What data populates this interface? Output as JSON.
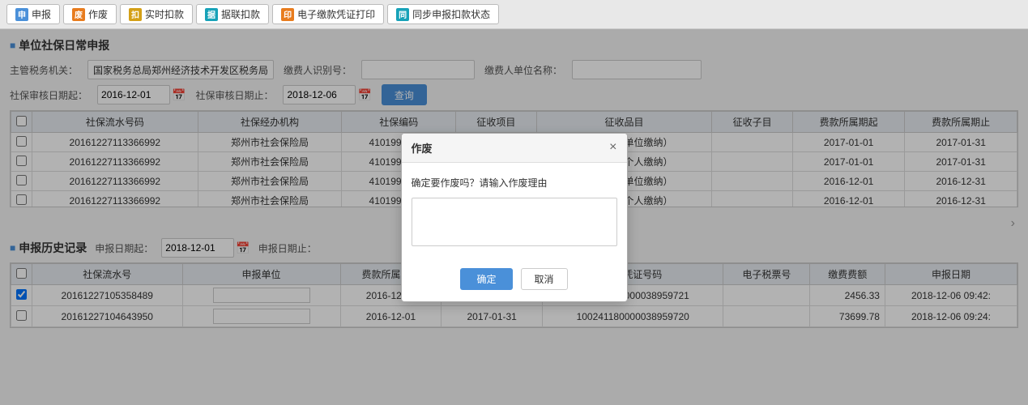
{
  "toolbar": {
    "buttons": [
      {
        "id": "btn-shenbaoo",
        "label": "申报",
        "iconColor": "icon-blue",
        "iconText": "申"
      },
      {
        "id": "btn-zuofei",
        "label": "作废",
        "iconColor": "icon-orange",
        "iconText": "废"
      },
      {
        "id": "btn-shishikouqian",
        "label": "实时扣款",
        "iconColor": "icon-yellow",
        "iconText": "扣"
      },
      {
        "id": "btn-jujian",
        "label": "据联扣款",
        "iconColor": "icon-cyan",
        "iconText": "据"
      },
      {
        "id": "btn-dianzifapiao",
        "label": "电子缴款凭证打印",
        "iconColor": "icon-orange",
        "iconText": "印"
      },
      {
        "id": "btn-tongbu",
        "label": "同步申报扣款状态",
        "iconColor": "icon-cyan",
        "iconText": "同"
      }
    ]
  },
  "page_title": "单位社保日常申报",
  "form": {
    "zhuguan_label": "主管税务机关：",
    "zhuguan_value": "国家税务总局郑州经济技术开发区税务局",
    "jiaofeiren_label": "缴费人识别号：",
    "jiaofeiren_placeholder": "",
    "danwei_label": "缴费人单位名称：",
    "danwei_placeholder": "",
    "sheheshennuqiqi_label": "社保审核日期起：",
    "sheheshennuqiqi_value": "2016-12-01",
    "sheheshenheqizhi_label": "社保审核日期止：",
    "sheheshenheqizhi_value": "2018-12-06",
    "query_btn": "查询"
  },
  "main_table": {
    "headers": [
      "",
      "社保流水号码",
      "社保经办机构",
      "社保编码",
      "征收项目",
      "征收品目",
      "征收子目",
      "费款所属期起",
      "费款所属期止"
    ],
    "rows": [
      {
        "checked": false,
        "liushui": "20161227113366992",
        "jingban": "郑州市社会保险局",
        "bianhao": "41019901533",
        "xiangmu": "",
        "pinmu": "失业保险（单位缴纳）",
        "zimu": "",
        "qiqi": "2017-01-01",
        "qizhi": "2017-01-31"
      },
      {
        "checked": false,
        "liushui": "20161227113366992",
        "jingban": "郑州市社会保险局",
        "bianhao": "41019901533",
        "xiangmu": "",
        "pinmu": "失业保险（个人缴纳）",
        "zimu": "",
        "qiqi": "2017-01-01",
        "qizhi": "2017-01-31"
      },
      {
        "checked": false,
        "liushui": "20161227113366992",
        "jingban": "郑州市社会保险局",
        "bianhao": "41019901533",
        "xiangmu": "",
        "pinmu": "失业保险（单位缴纳）",
        "zimu": "",
        "qiqi": "2016-12-01",
        "qizhi": "2016-12-31"
      },
      {
        "checked": false,
        "liushui": "20161227113366992",
        "jingban": "郑州市社会保险局",
        "bianhao": "41019901533",
        "xiangmu": "",
        "pinmu": "失业保险（个人缴纳）",
        "zimu": "",
        "qiqi": "2016-12-01",
        "qizhi": "2016-12-31"
      }
    ]
  },
  "history": {
    "section_title": "申报历史记录",
    "shenbaoriqi_label": "申报日期起：",
    "shenbaoriqi_value": "2018-12-01",
    "shenbaoriqi_end_label": "申报日期止：",
    "headers": [
      "",
      "社保流水号",
      "申报单位",
      "费款所属期起",
      "费款所属期止",
      "应征凭证号码",
      "电子税票号",
      "缴费费额",
      "申报日期"
    ],
    "rows": [
      {
        "checked": true,
        "liushui": "20161227105358489",
        "danwei": "",
        "qiqi": "2016-12-01",
        "qizhi": "2017-01-31",
        "yingzheng": "100241180000038959721",
        "dianzishuipiao": "",
        "jiaofei": "2456.33",
        "riqi": "2018-12-06 09:42:"
      },
      {
        "checked": false,
        "liushui": "20161227104643950",
        "danwei": "",
        "qiqi": "2016-12-01",
        "qizhi": "2017-01-31",
        "yingzheng": "100241180000038959720",
        "dianzishuipiao": "",
        "jiaofei": "73699.78",
        "riqi": "2018-12-06 09:24:"
      }
    ]
  },
  "modal": {
    "title": "作废",
    "close_label": "×",
    "message": "确定要作废吗？请输入作废理由",
    "textarea_placeholder": "",
    "confirm_label": "确定",
    "cancel_label": "取消"
  }
}
